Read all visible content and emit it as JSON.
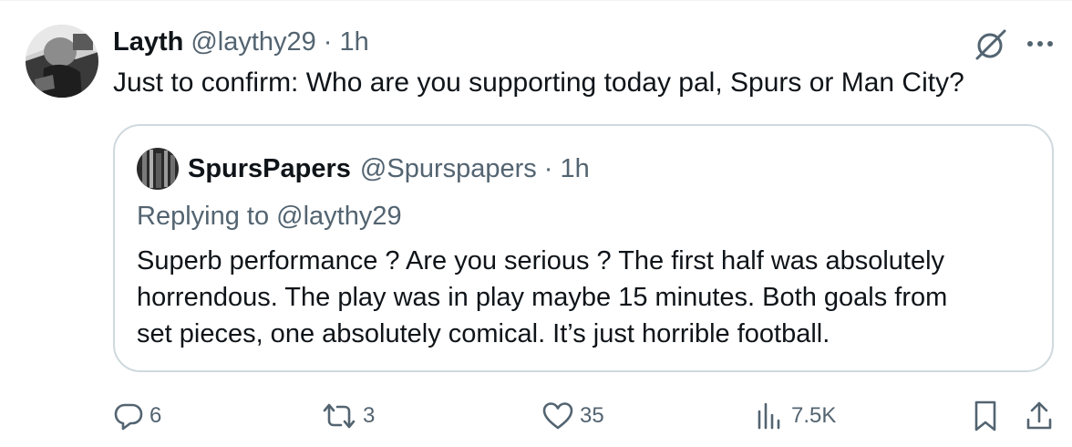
{
  "tweet": {
    "author_name": "Layth",
    "author_handle": "@laythy29",
    "separator": "·",
    "time": "1h",
    "text": "Just to confirm: Who are you supporting today pal, Spurs or Man City?"
  },
  "quoted_tweet": {
    "author_name": "SpursPapers",
    "author_handle": "@Spurspapers",
    "separator": "·",
    "time": "1h",
    "replying_to": "Replying to @laythy29",
    "text_lines": [
      "Superb performance ? Are you serious ? The first half was absolutely",
      "horrendous. The play was in play maybe 15 minutes. Both goals from",
      "set pieces, one absolutely comical. It’s just horrible football."
    ]
  },
  "actions": {
    "replies": "6",
    "reposts": "3",
    "likes": "35",
    "views": "7.5K"
  },
  "icons": {
    "grok": "grok-icon",
    "more": "more-icon",
    "reply": "reply-icon",
    "repost": "repost-icon",
    "like": "heart-icon",
    "views": "views-icon",
    "bookmark": "bookmark-icon",
    "share": "share-icon"
  },
  "colors": {
    "text_primary": "#0f1419",
    "text_secondary": "#536471",
    "border": "#cfd9de"
  }
}
